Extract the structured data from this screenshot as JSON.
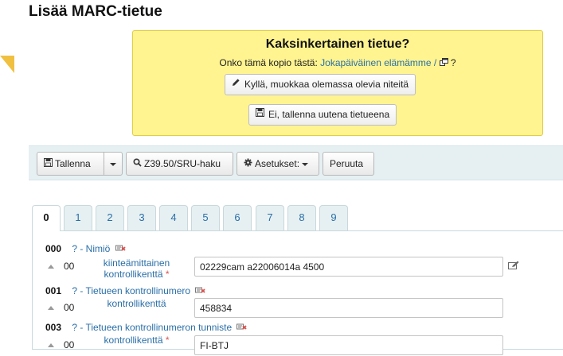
{
  "page": {
    "title": "Lisää MARC-tietue"
  },
  "duplicate": {
    "title": "Kaksinkertainen tietue?",
    "question_prefix": "Onko tämä kopio tästä:",
    "record_link": "Jokapäiväinen elämämme /",
    "question_suffix": "?",
    "edit_button": "Kyllä, muokkaa olemassa olevia niteitä",
    "new_button": "Ei, tallenna uutena tietueena"
  },
  "toolbar": {
    "save_label": "Tallenna",
    "z3950_label": "Z39.50/SRU-haku",
    "settings_label": "Asetukset:",
    "cancel_label": "Peruuta"
  },
  "tabs": [
    "0",
    "1",
    "2",
    "3",
    "4",
    "5",
    "6",
    "7",
    "8",
    "9"
  ],
  "fields": [
    {
      "tag": "000",
      "name": "? - Nimiö",
      "subfield_code": "00",
      "subfield_label": "kiinteämittainen kontrollikenttä",
      "required_mark": "*",
      "value": "02229cam a22006014a 4500"
    },
    {
      "tag": "001",
      "name": "? - Tietueen kontrollinumero",
      "subfield_code": "00",
      "subfield_label": "kontrollikenttä",
      "required_mark": "",
      "value": "458834"
    },
    {
      "tag": "003",
      "name": "? - Tietueen kontrollinumeron tunniste",
      "subfield_code": "00",
      "subfield_label": "kontrollikenttä",
      "required_mark": "*",
      "value": "FI-BTJ"
    }
  ],
  "colors": {
    "accent_link": "#2a6fa8",
    "warning_bg": "#fff490",
    "toolbar_bg": "#e6f0f2",
    "required": "#d9534f"
  }
}
